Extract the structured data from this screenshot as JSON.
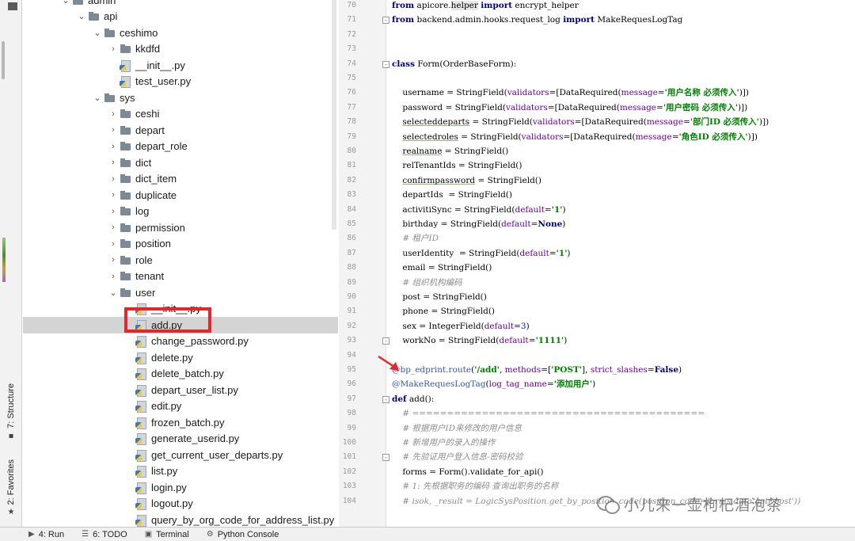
{
  "left_strip": {
    "structure_label": "7: Structure",
    "favorites_label": "2: Favorites"
  },
  "project_tree": {
    "rows": [
      {
        "label": "admin",
        "type": "folder",
        "level": 3,
        "arrow": "down"
      },
      {
        "label": "api",
        "type": "folder",
        "level": 4,
        "arrow": "down"
      },
      {
        "label": "ceshimo",
        "type": "folder",
        "level": 5,
        "arrow": "down"
      },
      {
        "label": "kkdfd",
        "type": "folder",
        "level": 6,
        "arrow": "right"
      },
      {
        "label": "__init__.py",
        "type": "py",
        "level": 6,
        "arrow": ""
      },
      {
        "label": "test_user.py",
        "type": "py",
        "level": 6,
        "arrow": ""
      },
      {
        "label": "sys",
        "type": "folder",
        "level": 5,
        "arrow": "down"
      },
      {
        "label": "ceshi",
        "type": "folder",
        "level": 6,
        "arrow": "right"
      },
      {
        "label": "depart",
        "type": "folder",
        "level": 6,
        "arrow": "right"
      },
      {
        "label": "depart_role",
        "type": "folder",
        "level": 6,
        "arrow": "right"
      },
      {
        "label": "dict",
        "type": "folder",
        "level": 6,
        "arrow": "right"
      },
      {
        "label": "dict_item",
        "type": "folder",
        "level": 6,
        "arrow": "right"
      },
      {
        "label": "duplicate",
        "type": "folder",
        "level": 6,
        "arrow": "right"
      },
      {
        "label": "log",
        "type": "folder",
        "level": 6,
        "arrow": "right"
      },
      {
        "label": "permission",
        "type": "folder",
        "level": 6,
        "arrow": "right"
      },
      {
        "label": "position",
        "type": "folder",
        "level": 6,
        "arrow": "right"
      },
      {
        "label": "role",
        "type": "folder",
        "level": 6,
        "arrow": "right"
      },
      {
        "label": "tenant",
        "type": "folder",
        "level": 6,
        "arrow": "right"
      },
      {
        "label": "user",
        "type": "folder",
        "level": 6,
        "arrow": "down"
      },
      {
        "label": "__init__.py",
        "type": "py",
        "level": 7,
        "arrow": ""
      },
      {
        "label": "add.py",
        "type": "py",
        "level": 7,
        "arrow": "",
        "selected": true
      },
      {
        "label": "change_password.py",
        "type": "py",
        "level": 7,
        "arrow": ""
      },
      {
        "label": "delete.py",
        "type": "py",
        "level": 7,
        "arrow": ""
      },
      {
        "label": "delete_batch.py",
        "type": "py",
        "level": 7,
        "arrow": ""
      },
      {
        "label": "depart_user_list.py",
        "type": "py",
        "level": 7,
        "arrow": ""
      },
      {
        "label": "edit.py",
        "type": "py",
        "level": 7,
        "arrow": ""
      },
      {
        "label": "frozen_batch.py",
        "type": "py",
        "level": 7,
        "arrow": ""
      },
      {
        "label": "generate_userid.py",
        "type": "py",
        "level": 7,
        "arrow": ""
      },
      {
        "label": "get_current_user_departs.py",
        "type": "py",
        "level": 7,
        "arrow": ""
      },
      {
        "label": "list.py",
        "type": "py",
        "level": 7,
        "arrow": ""
      },
      {
        "label": "login.py",
        "type": "py",
        "level": 7,
        "arrow": ""
      },
      {
        "label": "logout.py",
        "type": "py",
        "level": 7,
        "arrow": ""
      },
      {
        "label": "query_by_org_code_for_address_list.py",
        "type": "py",
        "level": 7,
        "arrow": ""
      }
    ]
  },
  "editor": {
    "lines": [
      {
        "no": "70",
        "html": "<span class=\"kw\">from</span> apicore.<span class=\"hl-word\">helper</span> <span class=\"kw\">import</span> encrypt_helper",
        "fold": ""
      },
      {
        "no": "71",
        "html": "<span class=\"kw\">from</span> backend.admin.hooks.request_log <span class=\"kw\">import</span> MakeRequesLogTag",
        "fold": "-"
      },
      {
        "no": "72",
        "html": "",
        "fold": ""
      },
      {
        "no": "73",
        "html": "",
        "fold": ""
      },
      {
        "no": "74",
        "html": "<span class=\"kw\">class</span> Form(OrderBaseForm):",
        "fold": "-"
      },
      {
        "no": "75",
        "html": "",
        "fold": ""
      },
      {
        "no": "76",
        "html": "    username = StringField(<span class=\"named\">validators</span>=[DataRequired(<span class=\"named\">message</span>=<span class=\"str\">'用户名称 必须传入'</span>)])",
        "fold": ""
      },
      {
        "no": "77",
        "html": "    password = StringField(<span class=\"named\">validators</span>=[DataRequired(<span class=\"named\">message</span>=<span class=\"str\">'用户密码 必须传入'</span>)])",
        "fold": ""
      },
      {
        "no": "78",
        "html": "    <span class=\"under\">selecteddeparts</span> = StringField(<span class=\"named\">validators</span>=[DataRequired(<span class=\"named\">message</span>=<span class=\"str\">'部门ID 必须传入'</span>)])",
        "fold": ""
      },
      {
        "no": "79",
        "html": "    <span class=\"under\">selectedroles</span> = StringField(<span class=\"named\">validators</span>=[DataRequired(<span class=\"named\">message</span>=<span class=\"str\">'角色ID 必须传入'</span>)])",
        "fold": ""
      },
      {
        "no": "80",
        "html": "    <span class=\"under\">realname</span> = StringField()",
        "fold": ""
      },
      {
        "no": "81",
        "html": "    relTenantIds = StringField()",
        "fold": ""
      },
      {
        "no": "82",
        "html": "    <span class=\"under\">confirmpassword</span> = StringField()",
        "fold": ""
      },
      {
        "no": "83",
        "html": "    departIds  = StringField()",
        "fold": ""
      },
      {
        "no": "84",
        "html": "    activitiSync = StringField(<span class=\"named\">default</span>=<span class=\"str\">'1'</span>)",
        "fold": ""
      },
      {
        "no": "85",
        "html": "    birthday = StringField(<span class=\"named\">default</span>=<span class=\"kw\">None</span>)",
        "fold": ""
      },
      {
        "no": "86",
        "html": "    <span class=\"cmt\"># 租户ID</span>",
        "fold": ""
      },
      {
        "no": "87",
        "html": "    userIdentity  = StringField(<span class=\"named\">default</span>=<span class=\"str\">'1'</span>)",
        "fold": ""
      },
      {
        "no": "88",
        "html": "    email = StringField()",
        "fold": ""
      },
      {
        "no": "89",
        "html": "    <span class=\"cmt\"># 组织机构编码</span>",
        "fold": ""
      },
      {
        "no": "90",
        "html": "    post = StringField()",
        "fold": ""
      },
      {
        "no": "91",
        "html": "    phone = StringField()",
        "fold": ""
      },
      {
        "no": "92",
        "html": "    sex = IntegerField(<span class=\"named\">default</span>=<span class=\"num\">3</span>)",
        "fold": ""
      },
      {
        "no": "93",
        "html": "    workNo = StringField(<span class=\"named\">default</span>=<span class=\"str\">'1111'</span>)",
        "fold": "-"
      },
      {
        "no": "94",
        "html": "",
        "fold": ""
      },
      {
        "no": "95",
        "html": "<span class=\"deco\">@bp_edprint.route</span>(<span class=\"str\">'/add'</span>, <span class=\"named\">methods</span>=[<span class=\"str\">'POST'</span>], <span class=\"named\">strict_slashes</span>=<span class=\"kw\">False</span>)",
        "fold": ""
      },
      {
        "no": "96",
        "html": "<span class=\"deco\">@MakeRequesLogTag</span>(<span class=\"named\">log_tag_name</span>=<span class=\"str\">'添加用户'</span>)",
        "fold": ""
      },
      {
        "no": "97",
        "html": "<span class=\"kw\">def</span> add():",
        "fold": "-"
      },
      {
        "no": "98",
        "html": "    <span class=\"cmt\"># ==========================================</span>",
        "fold": ""
      },
      {
        "no": "99",
        "html": "    <span class=\"cmt\"># 根据用户ID来修改的用户信息</span>",
        "fold": ""
      },
      {
        "no": "100",
        "html": "    <span class=\"cmt\"># 新增用户的录入的操作</span>",
        "fold": ""
      },
      {
        "no": "101",
        "html": "    <span class=\"cmt\"># 先验证用户登入信息-密码校验</span>",
        "fold": "-"
      },
      {
        "no": "102",
        "html": "    forms = Form().validate_for_api()",
        "fold": ""
      },
      {
        "no": "103",
        "html": "    <span class=\"cmt\"># 1: 先根据职务的编码 查询出职务的名称</span>",
        "fold": ""
      },
      {
        "no": "104",
        "html": "    <span class=\"cmt\"># isok, _result = LogicSysPosition.get_by_position_code(position_code=forms.data.get('post'))</span>",
        "fold": ""
      }
    ]
  },
  "watermark": {
    "text": "小儿来一壶枸杞酒泡茶"
  },
  "status_bar": {
    "items": [
      {
        "icon": "▶",
        "icon_name": "run-icon",
        "label": "4: Run"
      },
      {
        "icon": "☰",
        "icon_name": "todo-icon",
        "label": "6: TODO"
      },
      {
        "icon": "▣",
        "icon_name": "terminal-icon",
        "label": "Terminal"
      },
      {
        "icon": "⚙",
        "icon_name": "python-console-icon",
        "label": "Python Console"
      }
    ]
  },
  "colors": {
    "highlight_red": "#e8262a",
    "selected_row": "#d4d4d4",
    "keyword": "#000080",
    "string": "#008000",
    "comment": "#8c8c8c"
  }
}
